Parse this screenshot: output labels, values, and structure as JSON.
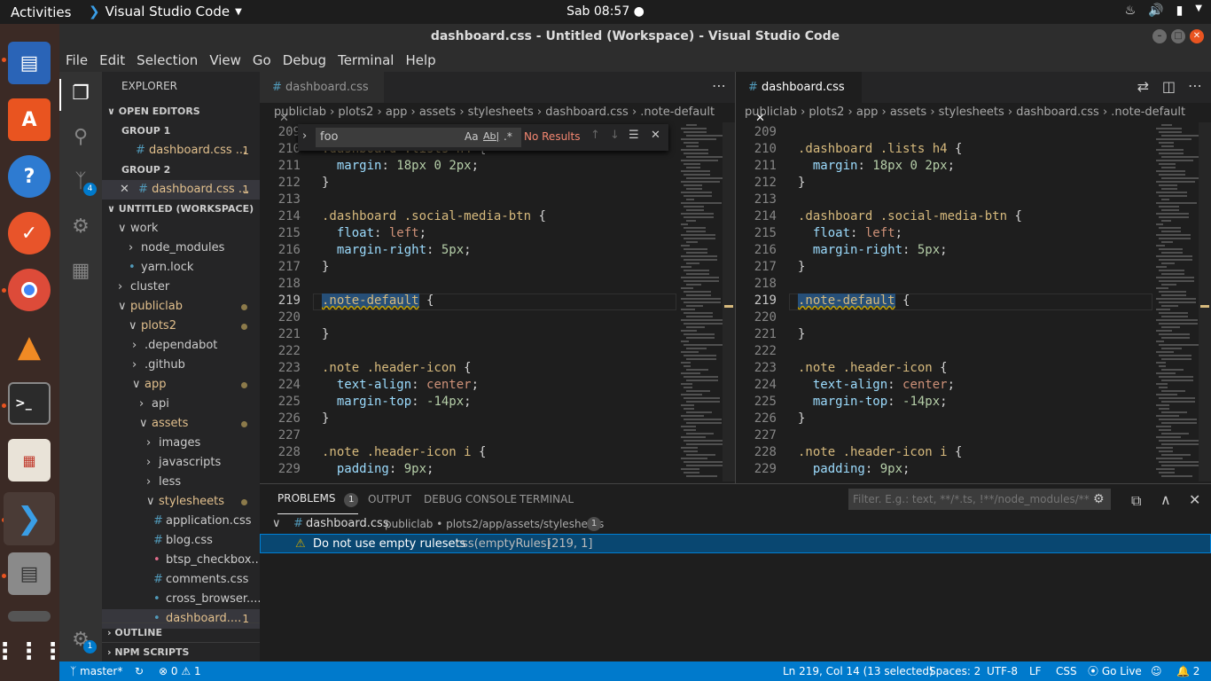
{
  "topbar": {
    "activities": "Activities",
    "app_name": "Visual Studio Code",
    "clock": "Sab 08:57 ●"
  },
  "window": {
    "title": "dashboard.css - Untitled (Workspace) - Visual Studio Code"
  },
  "menu": [
    "File",
    "Edit",
    "Selection",
    "View",
    "Go",
    "Debug",
    "Terminal",
    "Help"
  ],
  "activity_badges": {
    "scm": "4",
    "settings": "1"
  },
  "sidebar": {
    "title": "EXPLORER",
    "open_editors": "OPEN EDITORS",
    "group1": "GROUP 1",
    "group1_file": "dashboard.css ...",
    "group1_count": "1",
    "group2": "GROUP 2",
    "group2_file": "dashboard.css ...",
    "group2_count": "1",
    "workspace": "UNTITLED (WORKSPACE)",
    "tree": [
      {
        "label": "work",
        "arrow": "∨"
      },
      {
        "label": "node_modules",
        "arrow": "›"
      },
      {
        "label": "yarn.lock",
        "arrow": ""
      },
      {
        "label": "cluster",
        "arrow": "›"
      },
      {
        "label": "publiclab",
        "arrow": "∨"
      },
      {
        "label": "plots2",
        "arrow": "∨"
      },
      {
        "label": ".dependabot",
        "arrow": "›"
      },
      {
        "label": ".github",
        "arrow": "›"
      },
      {
        "label": "app",
        "arrow": "∨"
      },
      {
        "label": "api",
        "arrow": "›"
      },
      {
        "label": "assets",
        "arrow": "∨"
      },
      {
        "label": "images",
        "arrow": "›"
      },
      {
        "label": "javascripts",
        "arrow": "›"
      },
      {
        "label": "less",
        "arrow": "›"
      },
      {
        "label": "stylesheets",
        "arrow": "∨"
      },
      {
        "label": "application.css",
        "arrow": ""
      },
      {
        "label": "blog.css",
        "arrow": ""
      },
      {
        "label": "btsp_checkbox...",
        "arrow": ""
      },
      {
        "label": "comments.css",
        "arrow": ""
      },
      {
        "label": "cross_browser....",
        "arrow": ""
      },
      {
        "label": "dashboard....",
        "arrow": ""
      }
    ],
    "last_count": "1",
    "outline": "OUTLINE",
    "npm": "NPM SCRIPTS"
  },
  "editor": {
    "tab_label": "dashboard.css",
    "breadcrumbs": [
      "publiclab",
      "plots2",
      "app",
      "assets",
      "stylesheets",
      "dashboard.css",
      ".note-default"
    ],
    "lines": [
      {
        "n": "209",
        "t": ""
      },
      {
        "n": "210",
        "t": ".dashboard .lists h4 {"
      },
      {
        "n": "211",
        "t": "  margin: 18px 0 2px;"
      },
      {
        "n": "212",
        "t": "}"
      },
      {
        "n": "213",
        "t": ""
      },
      {
        "n": "214",
        "t": ".dashboard .social-media-btn {"
      },
      {
        "n": "215",
        "t": "  float: left;"
      },
      {
        "n": "216",
        "t": "  margin-right: 5px;"
      },
      {
        "n": "217",
        "t": "}"
      },
      {
        "n": "218",
        "t": ""
      },
      {
        "n": "219",
        "t": ".note-default {"
      },
      {
        "n": "220",
        "t": ""
      },
      {
        "n": "221",
        "t": "}"
      },
      {
        "n": "222",
        "t": ""
      },
      {
        "n": "223",
        "t": ".note .header-icon {"
      },
      {
        "n": "224",
        "t": "  text-align: center;"
      },
      {
        "n": "225",
        "t": "  margin-top: -14px;"
      },
      {
        "n": "226",
        "t": "}"
      },
      {
        "n": "227",
        "t": ""
      },
      {
        "n": "228",
        "t": ".note .header-icon i {"
      },
      {
        "n": "229",
        "t": "  padding: 9px;"
      }
    ]
  },
  "find": {
    "value": "foo",
    "opt_case": "Aa",
    "opt_word": "Ab|",
    "opt_regex": ".*",
    "result": "No Results"
  },
  "panel": {
    "tabs": {
      "problems": "PROBLEMS",
      "output": "OUTPUT",
      "debug": "DEBUG CONSOLE",
      "terminal": "TERMINAL"
    },
    "problem_count": "1",
    "filter_placeholder": "Filter. E.g.: text, **/*.ts, !**/node_modules/**",
    "group_file": "dashboard.css",
    "group_path": "publiclab • plots2/app/assets/stylesheets",
    "group_count": "1",
    "problem_message": "Do not use empty rulesets",
    "problem_source": "css(emptyRules)",
    "problem_location": "[219, 1]"
  },
  "status": {
    "branch": "master*",
    "errors": "0",
    "warnings": "1",
    "position": "Ln 219, Col 14 (13 selected)",
    "spaces": "Spaces: 2",
    "encoding": "UTF-8",
    "eol": "LF",
    "language": "CSS",
    "golive": "Go Live",
    "notifications": "2"
  }
}
